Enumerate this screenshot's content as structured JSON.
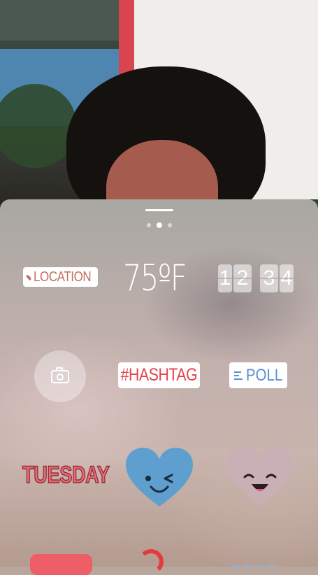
{
  "photo": {
    "description_icon": "camera-background"
  },
  "tray": {
    "pager": {
      "page_count": 3,
      "active_index": 1
    }
  },
  "stickers": {
    "location": {
      "label": "LOCATION",
      "icon": "location-pin-icon",
      "color": "#c4705f"
    },
    "temperature": {
      "label": "75ºF"
    },
    "time": {
      "digits": [
        "1",
        "2",
        "3",
        "4"
      ]
    },
    "camera": {
      "icon": "camera-icon"
    },
    "hashtag": {
      "label": "#HASHTAG",
      "color": "#e2434d"
    },
    "poll": {
      "label": "POLL",
      "icon": "poll-lines-icon",
      "color": "#5b8fd1"
    },
    "day": {
      "label": "TUESDAY",
      "color": "#ea6b75"
    },
    "wink_heart": {
      "icon": "winking-heart-icon",
      "color": "#5f9fcf"
    },
    "smile_heart": {
      "icon": "smiling-heart-icon",
      "color": "#c9b0b4"
    }
  }
}
